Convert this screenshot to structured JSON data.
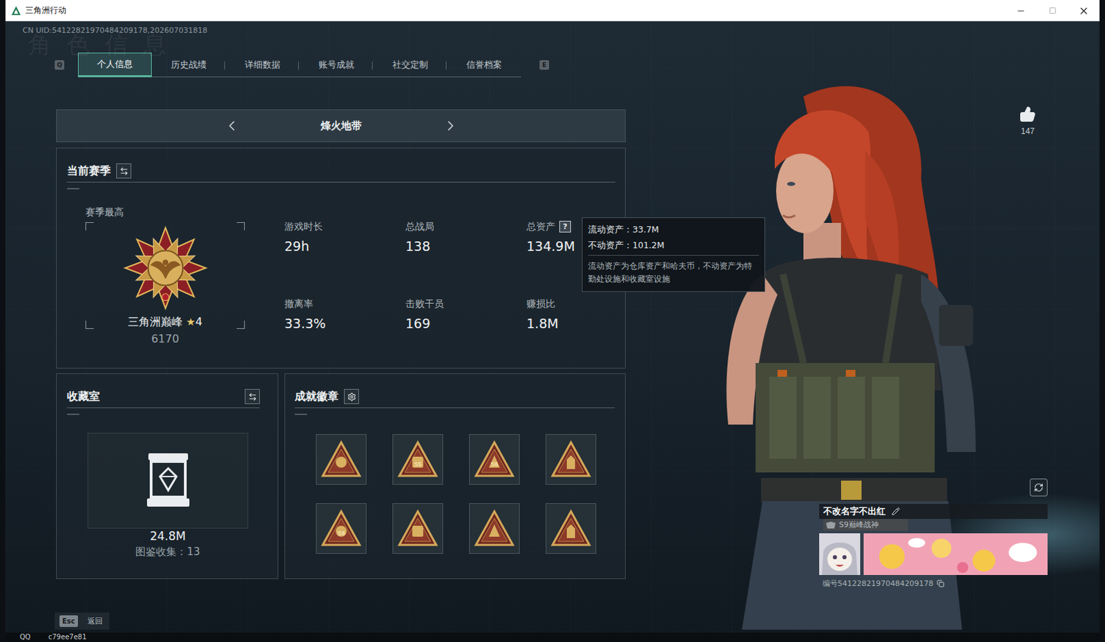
{
  "window": {
    "title": "三角洲行动"
  },
  "uid": "CN UID:54122821970484209178,202607031818",
  "watermark": "角色信息",
  "tabs": {
    "prev_key": "Q",
    "next_key": "E",
    "items": [
      {
        "label": "个人信息",
        "selected": true
      },
      {
        "label": "历史战绩",
        "selected": false
      },
      {
        "label": "详细数据",
        "selected": false
      },
      {
        "label": "账号成就",
        "selected": false
      },
      {
        "label": "社交定制",
        "selected": false
      },
      {
        "label": "信誉档案",
        "selected": false
      }
    ]
  },
  "mode": {
    "label": "烽火地带"
  },
  "season": {
    "title": "当前赛季",
    "best_label": "赛季最高",
    "rank": "三角洲巅峰",
    "star": "★",
    "stars_text": "4",
    "score": "6170",
    "stats": [
      {
        "label": "游戏时长",
        "value": "29h"
      },
      {
        "label": "总战局",
        "value": "138"
      },
      {
        "label": "总资产",
        "value": "134.9M",
        "help": "?"
      },
      {
        "label": "撤离率",
        "value": "33.3%"
      },
      {
        "label": "击败干员",
        "value": "169"
      },
      {
        "label": "赚损比",
        "value": "1.8M"
      }
    ]
  },
  "asset_tooltip": {
    "lines": [
      "流动资产：33.7M",
      "不动资产：101.2M"
    ],
    "note": "流动资产为仓库资产和哈夫币，不动资产为特勤处设施和收藏室设施"
  },
  "collection": {
    "title": "收藏室",
    "value": "24.8M",
    "catalog": "图鉴收集：13"
  },
  "badges": {
    "title": "成就徽章",
    "items": [
      {
        "label": ""
      },
      {
        "label": "S5"
      },
      {
        "label": "S6"
      },
      {
        "label": ""
      },
      {
        "label": "S8"
      },
      {
        "label": ""
      },
      {
        "label": ""
      },
      {
        "label": ""
      }
    ]
  },
  "profile": {
    "likes": "147",
    "name": "不改名字不出红",
    "title": "S9巅峰战神",
    "id": "编号54122821970484209178"
  },
  "footer": {
    "key": "Esc",
    "label": "返回"
  },
  "taskbar": [
    "QQ",
    "c79ee7e81"
  ]
}
